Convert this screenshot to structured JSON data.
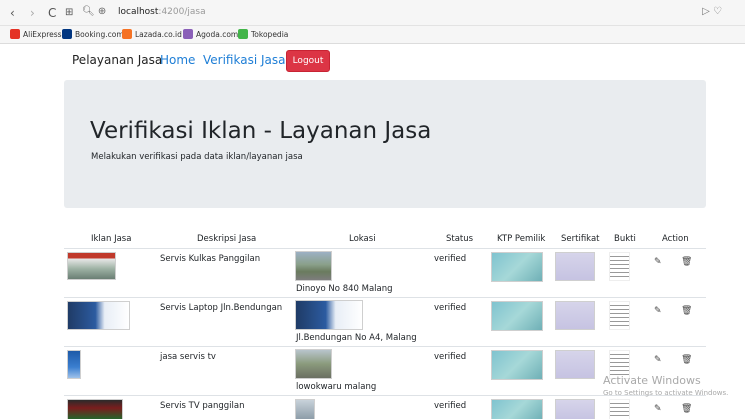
{
  "browser": {
    "back": "‹",
    "forward": "›",
    "reload": "C",
    "apps": "⊞",
    "url_host": "localhost",
    "url_path": ":4200/jasa",
    "bookmarks": [
      {
        "label": "AliExpress",
        "color": "#e43225"
      },
      {
        "label": "Booking.com",
        "color": "#003580"
      },
      {
        "label": "Lazada.co.id",
        "color": "#f57224"
      },
      {
        "label": "Agoda.com",
        "color": "#8a5fb8"
      },
      {
        "label": "Tokopedia",
        "color": "#42b549"
      }
    ]
  },
  "navbar": {
    "brand": "Pelayanan Jasa",
    "home": "Home",
    "verifikasi": "Verifikasi Jasa",
    "logout": "Logout"
  },
  "jumbotron": {
    "title": "Verifikasi Iklan - Layanan Jasa",
    "subtitle": "Melakukan verifikasi pada data iklan/layanan jasa"
  },
  "table": {
    "headers": [
      "Iklan Jasa",
      "Deskripsi Jasa",
      "Lokasi",
      "Status",
      "KTP Pemilik",
      "Sertifikat",
      "Bukti",
      "Action"
    ],
    "rows": [
      {
        "deskripsi": "Servis Kulkas Panggilan",
        "lokasi": "Dinoyo No 840 Malang",
        "status": "verified"
      },
      {
        "deskripsi": "Servis Laptop Jln.Bendungan",
        "lokasi": "Jl.Bendungan No A4, Malang",
        "status": "verified"
      },
      {
        "deskripsi": "jasa servis tv",
        "lokasi": "lowokwaru malang",
        "status": "verified"
      },
      {
        "deskripsi": "Servis TV panggilan",
        "lokasi": "",
        "status": "verified"
      }
    ]
  },
  "watermark": {
    "title": "Activate Windows",
    "subtitle": "Go to Settings to activate Windows."
  },
  "colors": {
    "accent": "#1e7ed6",
    "danger": "#dc3545",
    "jumbotron": "#e9ecef"
  }
}
